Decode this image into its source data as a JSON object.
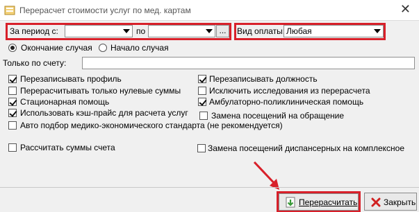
{
  "window": {
    "title": "Перерасчет стоимости услуг по мед. картам",
    "close_glyph": "✕"
  },
  "period": {
    "label": "За период с:",
    "from_value": "",
    "to_label": "по",
    "to_value": "",
    "dots_label": "..."
  },
  "payment": {
    "label": "Вид оплаты:",
    "value": "Любая"
  },
  "radios": [
    {
      "label": "Окончание случая",
      "selected": true
    },
    {
      "label": "Начало случая",
      "selected": false
    }
  ],
  "account_only": {
    "label": "Только по счету:",
    "value": ""
  },
  "checks_left": [
    {
      "label": "Перезаписывать профиль",
      "checked": true
    },
    {
      "label": "Перерасчитывать только нулевые суммы",
      "checked": false
    },
    {
      "label": "Стационарная помощь",
      "checked": true
    },
    {
      "label": "Использовать кэш-прайс для расчета услуг",
      "checked": true
    },
    {
      "label": "Авто подбор медико-экономического стандарта (не рекомендуется)",
      "checked": false
    },
    {
      "label": "Рассчитать суммы счета",
      "checked": false
    }
  ],
  "checks_right": [
    {
      "label": "Перезаписывать должность",
      "checked": true
    },
    {
      "label": "Исключить исследования из перерасчета",
      "checked": false
    },
    {
      "label": "Амбулаторно-поликлиническая помощь",
      "checked": true
    },
    {
      "label": "Замена посещений на обращение",
      "checked": false
    },
    {
      "label": "Замена посещений диспансерных на комплексное",
      "checked": false
    }
  ],
  "buttons": {
    "recalc": "Перерасчитать",
    "close": "Закрыть"
  },
  "colors": {
    "highlight": "#d8202a",
    "recalc_icon": "#3a9a3a",
    "close_icon": "#d02020"
  }
}
